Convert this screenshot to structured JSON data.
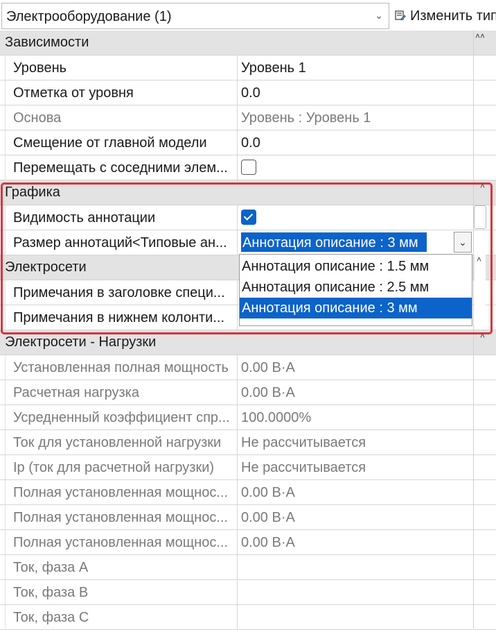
{
  "type_selector": {
    "value": "Электрооборудование (1)"
  },
  "edit_type": {
    "label": "Изменить тип"
  },
  "groups": {
    "dependencies": {
      "title": "Зависимости",
      "rows": [
        {
          "name": "Уровень",
          "value": "Уровень 1"
        },
        {
          "name": "Отметка от уровня",
          "value": "0.0"
        },
        {
          "name": "Основа",
          "value": "Уровень : Уровень 1"
        },
        {
          "name": "Смещение от главной модели",
          "value": "0.0"
        },
        {
          "name": "Перемещать с соседними элем...",
          "checked": false
        }
      ]
    },
    "graphics": {
      "title": "Графика",
      "rows": [
        {
          "name": "Видимость аннотации",
          "checked": true
        },
        {
          "name": "Размер аннотаций<Типовые ан...",
          "value": "Аннотация описание : 3 мм"
        }
      ]
    },
    "electrical": {
      "title": "Электросети",
      "rows": [
        {
          "name": "Примечания в заголовке специ..."
        },
        {
          "name": "Примечания в нижнем колонти..."
        }
      ]
    },
    "loads": {
      "title": "Электросети - Нагрузки",
      "rows": [
        {
          "name": "Установленная полная мощность",
          "value": "0.00 В·А"
        },
        {
          "name": "Расчетная нагрузка",
          "value": "0.00 В·А"
        },
        {
          "name": "Усредненный коэффициент спр...",
          "value": "100.0000%"
        },
        {
          "name": "Ток для установленной нагрузки",
          "value": "Не рассчитывается"
        },
        {
          "name": "Iр (ток для расчетной нагрузки)",
          "value": "Не рассчитывается"
        },
        {
          "name": "Полная установленная мощнос...",
          "value": "0.00 В·А"
        },
        {
          "name": "Полная установленная мощнос...",
          "value": "0.00 В·А"
        },
        {
          "name": "Полная установленная мощнос...",
          "value": "0.00 В·А"
        },
        {
          "name": "Ток, фаза A",
          "value": ""
        },
        {
          "name": "Ток, фаза B",
          "value": ""
        },
        {
          "name": "Ток, фаза C",
          "value": ""
        }
      ]
    }
  },
  "dropdown": {
    "options": [
      "Аннотация описание : 1.5 мм",
      "Аннотация описание : 2.5 мм",
      "Аннотация описание : 3 мм"
    ],
    "selected_index": 2
  },
  "colors": {
    "accent": "#0c63c9",
    "highlight_border": "#d9343b",
    "group_bg": "#e3e3e3"
  },
  "icons": [
    "chevron-down-icon",
    "edit-type-icon",
    "collapse-icon",
    "checkbox-check-icon"
  ]
}
